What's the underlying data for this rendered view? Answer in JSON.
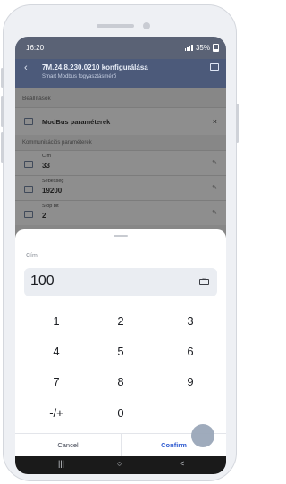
{
  "status_bar": {
    "time": "16:20",
    "battery": "35%",
    "battery_level": 0.35
  },
  "header": {
    "title": "7M.24.8.230.0210 konfigurálása",
    "subtitle": "Smart Modbus fogyasztásmérő"
  },
  "background": {
    "section_settings": "Beállítások",
    "modbus_card": {
      "title": "ModBus paraméterek",
      "close": "×"
    },
    "section_comm": "Kommunikációs paraméterek",
    "fields": [
      {
        "label": "Cím",
        "value": "33"
      },
      {
        "label": "Sebesség",
        "value": "19200"
      },
      {
        "label": "Stop bit",
        "value": "2"
      }
    ]
  },
  "sheet": {
    "field_label": "Cím",
    "input_value": "100",
    "keys": [
      "1",
      "2",
      "3",
      "4",
      "5",
      "6",
      "7",
      "8",
      "9",
      "-/+",
      "0"
    ],
    "cancel_label": "Cancel",
    "confirm_label": "Confirm"
  },
  "nav_bar": {
    "recents": "|||",
    "home": "○",
    "back": "<"
  },
  "colors": {
    "accent": "#2f5bd0",
    "header": "#4c5a7a",
    "scrim": "#878787"
  }
}
